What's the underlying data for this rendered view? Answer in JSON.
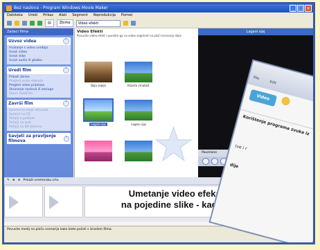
{
  "window": {
    "title": "Bez naslova - Program Windows Movie Maker"
  },
  "menu": [
    "Datoteka",
    "Uredi",
    "Prikaz",
    "Alati",
    "Segment",
    "Reprodukcija",
    "Pomoć"
  ],
  "toolbar": {
    "zbirke": "Zbirke",
    "combo": "Video efekti"
  },
  "tasks": {
    "header": "Zadaci filma",
    "groups": [
      {
        "title": "Uzvoz videa",
        "links": [
          "Hvatanje s video uređaja",
          "Uvezi video",
          "Uvezi slike",
          "Uvezi audio ili glazbu"
        ]
      },
      {
        "title": "Uredi film",
        "links": [
          "Prikaži zbirke",
          "Pregled video efekata",
          "Pregled video prijelaza",
          "Stvaranje naslova ili zasluga",
          "Stvori AutoFilm"
        ]
      },
      {
        "title": "Završi film",
        "links": [
          "Spremi na moje računalo",
          "Spremi na CD",
          "Pošalji e-poštom",
          "Pošalji na web",
          "Pošalji na DV kameru"
        ]
      },
      {
        "title": "Savjeti za pravljenje filmova",
        "links": []
      }
    ]
  },
  "collection": {
    "title": "Video Efekti",
    "subtitle": "Povucite video efekt i spustite ga na video segment na ploči scenarija dolje",
    "items": [
      {
        "label": "Boja sepija"
      },
      {
        "label": "Klizača zrnatost"
      },
      {
        "label": "Lagani sjaj"
      },
      {
        "label": "Lagani sjaj"
      }
    ]
  },
  "monitor": {
    "title": "Lagani sjaj",
    "status": "Pauzirano"
  },
  "storyboard": {
    "label": "Prikaži vremensku crtu",
    "overlay_line1": "Umetanje video efekata",
    "overlay_line2": "na pojedine slike - kadrove"
  },
  "statusbar": "Povucite medij na ploču scenarija kako biste počeli s izradom filma.",
  "card": {
    "menu": [
      "File",
      "Edit"
    ],
    "button": "Video",
    "text1": "Korištenje programa zvuka iz",
    "text2": "(ve i r",
    "text3": "dije"
  }
}
